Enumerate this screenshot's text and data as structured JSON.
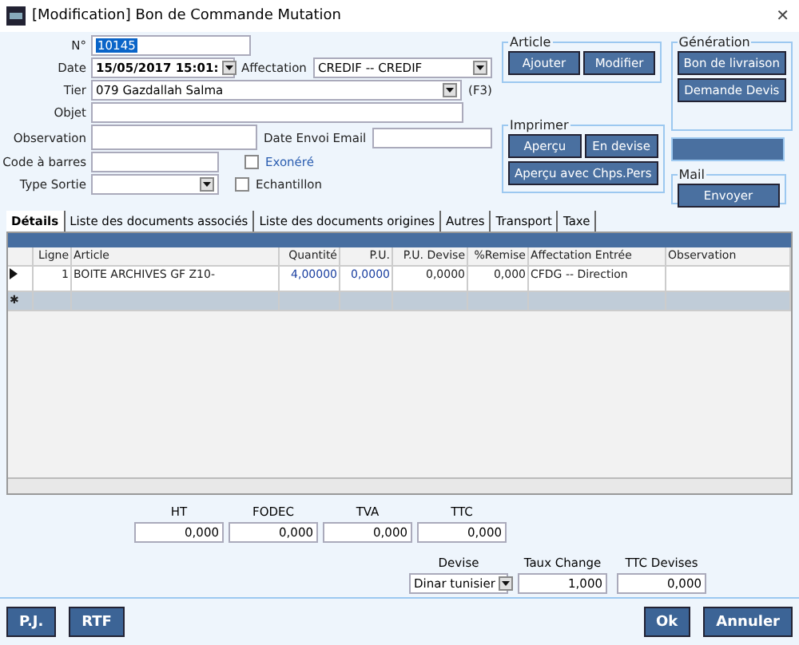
{
  "window": {
    "title": "[Modification] Bon de Commande Mutation",
    "close": "✕"
  },
  "form": {
    "numero": {
      "label": "N°",
      "value": "10145"
    },
    "date": {
      "label": "Date",
      "value": "15/05/2017 15:01:"
    },
    "affectation": {
      "label": "Affectation",
      "value": "CREDIF -- CREDIF"
    },
    "tier": {
      "label": "Tier",
      "value": "079 Gazdallah Salma",
      "hint": "(F3)"
    },
    "objet": {
      "label": "Objet"
    },
    "observation": {
      "label": "Observation"
    },
    "date_envoi_email": {
      "label": "Date Envoi Email"
    },
    "code_barres": {
      "label": "Code à barres"
    },
    "exonere": {
      "label": "Exonéré",
      "checked": false
    },
    "type_sortie": {
      "label": "Type Sortie"
    },
    "echantillon": {
      "label": "Echantillon",
      "checked": false
    }
  },
  "groups": {
    "article": {
      "title": "Article",
      "buttons": [
        "Ajouter",
        "Modifier"
      ]
    },
    "imprimer": {
      "title": "Imprimer",
      "buttons": [
        "Aperçu",
        "En devise",
        "Aperçu avec Chps.Pers"
      ]
    },
    "generation": {
      "title": "Génération",
      "buttons": [
        "Bon de livraison",
        "Demande Devis"
      ]
    },
    "mail": {
      "title": "Mail",
      "buttons": [
        "Envoyer"
      ]
    }
  },
  "tabs": [
    {
      "label": "Détails",
      "selected": true
    },
    {
      "label": "Liste des documents associés",
      "selected": false
    },
    {
      "label": "Liste des documents origines",
      "selected": false
    },
    {
      "label": "Autres",
      "selected": false
    },
    {
      "label": "Transport",
      "selected": false
    },
    {
      "label": "Taxe",
      "selected": false
    }
  ],
  "table": {
    "columns": [
      "Ligne",
      "Article",
      "Quantité",
      "P.U.",
      "P.U. Devise",
      "%Remise",
      "Affectation Entrée",
      "Observation"
    ],
    "rows": [
      {
        "current": true,
        "cells": [
          "1",
          "BOITE ARCHIVES GF Z10-",
          "4,00000",
          "0,0000",
          "0,0000",
          "0,000",
          "CFDG -- Direction",
          ""
        ]
      }
    ],
    "new_row_marker": "✱"
  },
  "totals": [
    {
      "label": "HT",
      "value": "0,000"
    },
    {
      "label": "FODEC",
      "value": "0,000"
    },
    {
      "label": "TVA",
      "value": "0,000"
    },
    {
      "label": "TTC",
      "value": "0,000"
    }
  ],
  "currency": {
    "devise": {
      "label": "Devise",
      "value": "Dinar tunisier"
    },
    "taux": {
      "label": "Taux Change",
      "value": "1,000"
    },
    "ttc_devises": {
      "label": "TTC Devises",
      "value": "0,000"
    }
  },
  "footer": {
    "left_buttons": [
      "P.J.",
      "RTF"
    ],
    "right_buttons": [
      "Ok",
      "Annuler"
    ]
  }
}
